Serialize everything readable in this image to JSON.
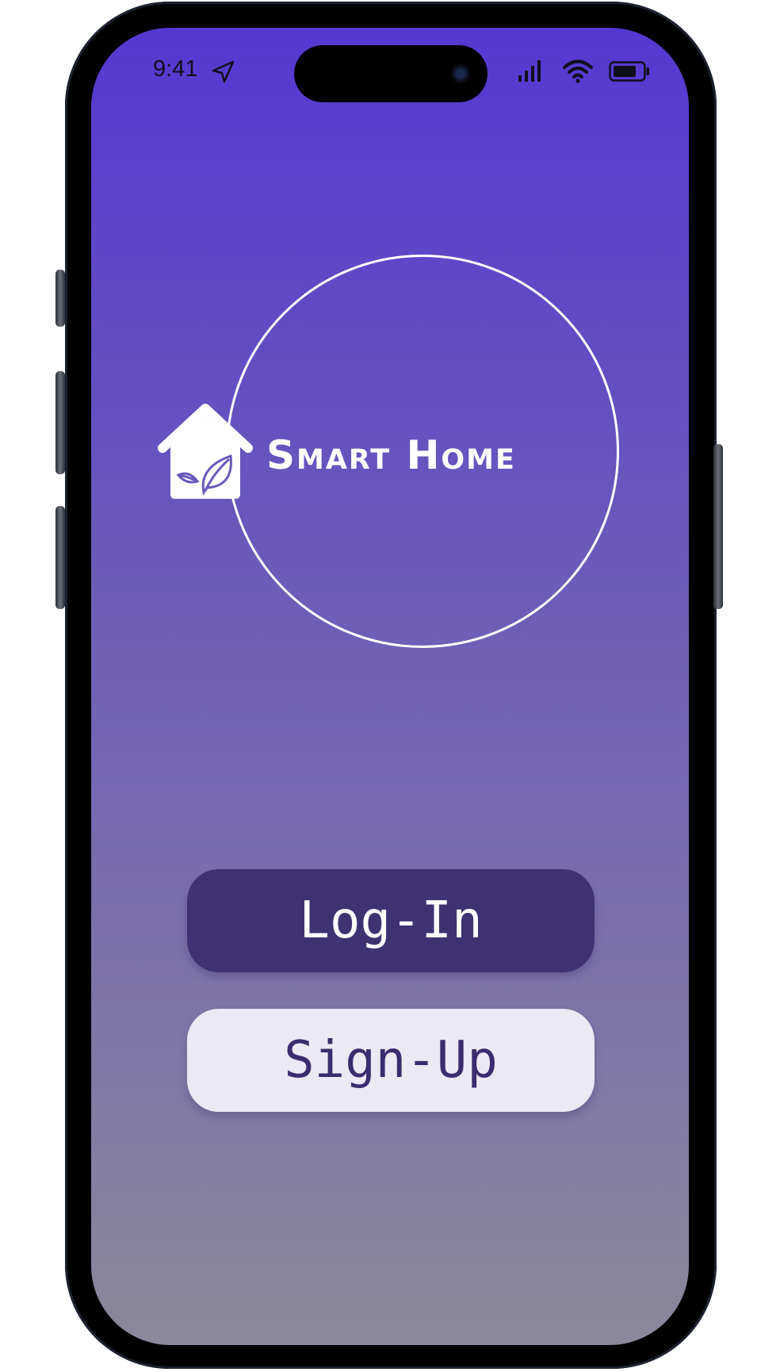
{
  "status_bar": {
    "time": "9:41"
  },
  "brand": {
    "name": "Smart Home"
  },
  "actions": {
    "login_label": "Log-In",
    "signup_label": "Sign-Up"
  },
  "colors": {
    "gradient_top": "#5538d2",
    "gradient_bottom": "#8a8899",
    "login_bg": "#3f3273",
    "signup_bg": "#ebe9f3",
    "signup_text": "#3a2c6e"
  },
  "icons": [
    "location-arrow-icon",
    "cellular-signal-icon",
    "wifi-icon",
    "battery-icon",
    "house-leaf-logo-icon"
  ]
}
